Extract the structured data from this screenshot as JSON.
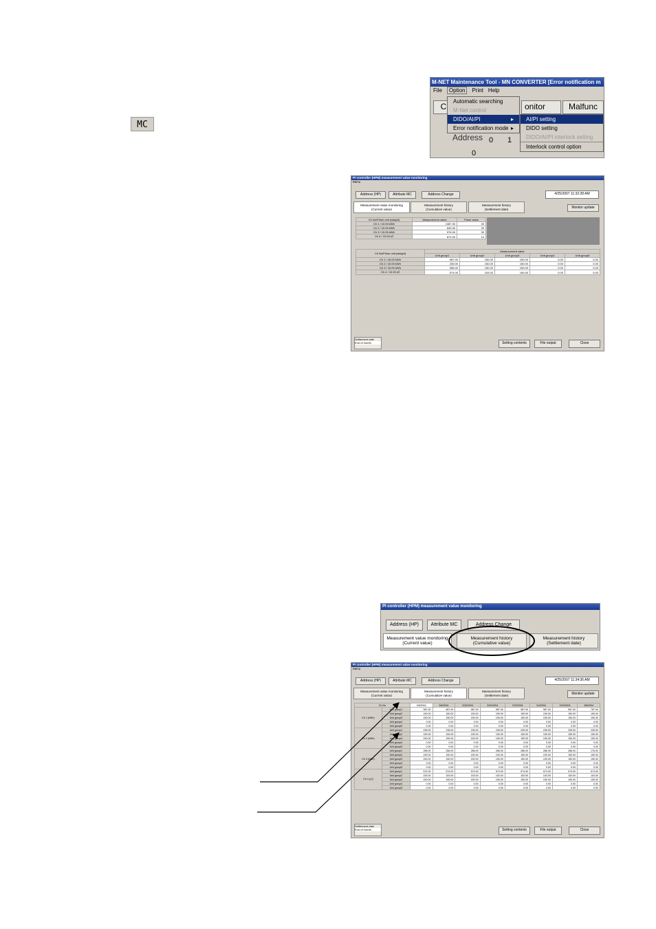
{
  "mc_button": {
    "label": "MC"
  },
  "menu_screenshot": {
    "title": "M-NET Maintenance Tool - MN CONVERTER [Error notification m",
    "menubar": [
      "File",
      "Option",
      "Print",
      "Help"
    ],
    "bg_buttons": [
      "C",
      "onitor",
      "Malfunc"
    ],
    "address_label": "Address",
    "address_digits": [
      "0",
      "1"
    ],
    "address_row2": "0",
    "option_menu": [
      "Automatic searching",
      "M-Net control",
      "DIDO/AI/PI",
      "Error notification mode"
    ],
    "submenu": [
      "AI/PI setting",
      "DIDO setting",
      "DIDO/AI/PI interlock setting",
      "Interlock control option"
    ]
  },
  "pi_window": {
    "title": "PI controller (HPM) measurement value monitoring",
    "menu": "Menu",
    "top_buttons": [
      "Address (HP)",
      "Attribute MC",
      "Address Change"
    ],
    "datetime": "4/25/2007 11:32:28 AM",
    "tabs": [
      [
        "Measurement value monitoring",
        "(Current value)"
      ],
      [
        "Measurement history",
        "(Cumulative value)"
      ],
      [
        "Measurement history",
        "(Settlement date)"
      ]
    ],
    "monitor_update": "Monitor update",
    "bottom_left_labels": [
      "Settlement date",
      "End of month"
    ],
    "bottom_buttons": [
      "Setting contents",
      "File output",
      "Close"
    ]
  },
  "table_current": {
    "headers": [
      "Ch No/Pulse unit (weight)",
      "Measurement value",
      "Pulse value"
    ],
    "rows": [
      [
        "Ch 1 / 10.00 kWh",
        "1387.00",
        "30"
      ],
      [
        "Ch 2 / 10.00 kWh",
        "645.00",
        "30"
      ],
      [
        "Ch 3 / 10.00 kWh",
        "576.00",
        "30"
      ],
      [
        "Ch 4 / 10.00 ㎥",
        "874.00",
        "10"
      ]
    ]
  },
  "table_units": {
    "header": "Ch No/Pulse unit (weight)",
    "group_header": "Measurement value",
    "columns": [
      "Unit group1",
      "Unit group2",
      "Unit group3",
      "Unit group4",
      "Unit group5"
    ],
    "rows": [
      [
        "Ch 1 / 10.00 kWh",
        "987.00",
        "150.00",
        "150.00",
        "0.00",
        "0.00"
      ],
      [
        "Ch 2 / 10.00 kWh",
        "235.00",
        "150.00",
        "150.00",
        "0.00",
        "0.00"
      ],
      [
        "Ch 3 / 10.00 kWh",
        "286.00",
        "150.00",
        "150.00",
        "0.00",
        "0.00"
      ],
      [
        "Ch 4 / 10.00 ㎥",
        "574.00",
        "153.00",
        "150.00",
        "0.00",
        "0.00"
      ]
    ]
  },
  "crop_screenshot": {
    "title": "PI controller (HPM) measurement value monitoring",
    "buttons": [
      "Address (HP)",
      "Attribute MC",
      "Address Change"
    ],
    "tabs": [
      [
        "Measurement value monitoring",
        "(Current value)"
      ],
      [
        "Measurement history",
        "(Cumulative value)"
      ],
      [
        "Measurement history",
        "(Settlement date)"
      ]
    ]
  },
  "pi_window2": {
    "datetime": "4/25/2007 11:34:36 AM"
  },
  "history_table": {
    "ch_header": "Ch No",
    "dates": [
      "2/8/2004",
      "3/8/2004",
      "2/20/2004",
      "3/20/2004",
      "7/20/2004",
      "2/4/2004",
      "2/20/2004",
      "3/8/2004"
    ],
    "groups": [
      {
        "ch": "Ch 1 (kWh)",
        "rows": [
          [
            "Unit group1",
            "987.00",
            "987.00",
            "987.00",
            "987.00",
            "987.00",
            "987.00",
            "987.00",
            "787.00"
          ],
          [
            "Unit group2",
            "150.00",
            "150.00",
            "150.00",
            "150.00",
            "150.00",
            "150.00",
            "150.00",
            "150.00"
          ],
          [
            "Unit group3",
            "150.00",
            "150.00",
            "150.00",
            "150.00",
            "150.00",
            "150.00",
            "150.00",
            "150.00"
          ],
          [
            "Unit group4",
            "0.00",
            "0.00",
            "0.00",
            "0.00",
            "0.00",
            "0.00",
            "0.00",
            "0.00"
          ],
          [
            "Unit group5",
            "0.00",
            "0.00",
            "0.00",
            "0.00",
            "0.00",
            "0.00",
            "0.00",
            "0.00"
          ]
        ]
      },
      {
        "ch": "Ch 2 (kWh)",
        "rows": [
          [
            "Unit group1",
            "235.00",
            "235.00",
            "235.00",
            "235.00",
            "235.00",
            "235.00",
            "235.00",
            "235.00"
          ],
          [
            "Unit group2",
            "150.00",
            "150.00",
            "150.00",
            "150.00",
            "150.00",
            "150.00",
            "150.00",
            "150.00"
          ],
          [
            "Unit group3",
            "150.00",
            "150.00",
            "150.00",
            "150.00",
            "150.00",
            "150.00",
            "150.00",
            "150.00"
          ],
          [
            "Unit group4",
            "0.00",
            "0.00",
            "0.00",
            "0.00",
            "0.00",
            "0.00",
            "0.00",
            "0.00"
          ],
          [
            "Unit group5",
            "0.00",
            "0.00",
            "0.00",
            "0.00",
            "0.00",
            "0.00",
            "0.00",
            "0.00"
          ]
        ]
      },
      {
        "ch": "Ch 3 (kWh)",
        "rows": [
          [
            "Unit group1",
            "286.00",
            "286.00",
            "286.00",
            "286.00",
            "286.00",
            "286.00",
            "286.00",
            "176.00"
          ],
          [
            "Unit group2",
            "150.00",
            "150.00",
            "150.00",
            "150.00",
            "150.00",
            "150.00",
            "150.00",
            "150.00"
          ],
          [
            "Unit group3",
            "150.00",
            "150.00",
            "150.00",
            "150.00",
            "150.00",
            "150.00",
            "150.00",
            "150.00"
          ],
          [
            "Unit group4",
            "0.00",
            "0.00",
            "0.00",
            "0.00",
            "0.00",
            "0.00",
            "0.00",
            "0.00"
          ],
          [
            "Unit group5",
            "0.00",
            "0.00",
            "0.00",
            "0.00",
            "0.00",
            "0.00",
            "0.00",
            "0.00"
          ]
        ]
      },
      {
        "ch": "Ch 4 (㎥)",
        "rows": [
          [
            "Unit group1",
            "574.00",
            "574.00",
            "574.00",
            "574.00",
            "574.00",
            "574.00",
            "574.00",
            "574.00"
          ],
          [
            "Unit group2",
            "153.00",
            "153.00",
            "153.00",
            "153.00",
            "153.00",
            "153.00",
            "153.00",
            "153.00"
          ],
          [
            "Unit group3",
            "150.00",
            "150.00",
            "150.00",
            "150.00",
            "150.00",
            "150.00",
            "150.00",
            "150.00"
          ],
          [
            "Unit group4",
            "0.00",
            "0.00",
            "0.00",
            "0.00",
            "0.00",
            "0.00",
            "0.00",
            "0.00"
          ],
          [
            "Unit group5",
            "0.00",
            "0.00",
            "0.00",
            "0.00",
            "0.00",
            "0.00",
            "0.00",
            "0.00"
          ]
        ]
      }
    ]
  }
}
